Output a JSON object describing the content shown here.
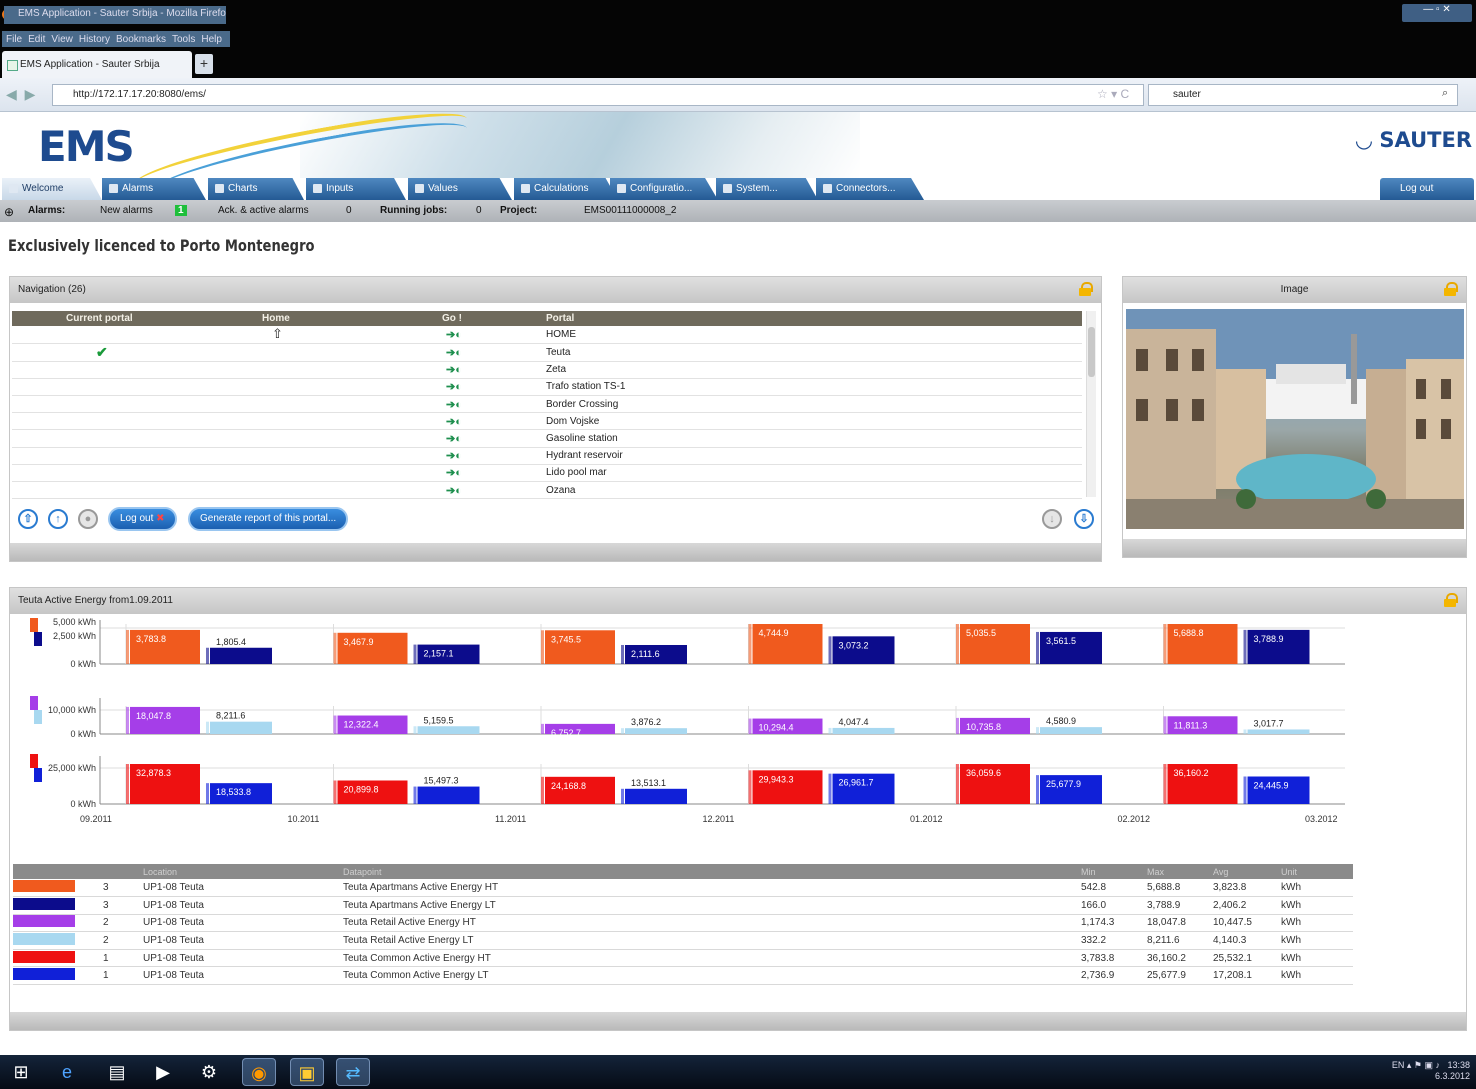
{
  "browser": {
    "window_title": "EMS Application - Sauter Srbija - Mozilla Firefox",
    "menu": [
      "File",
      "Edit",
      "View",
      "History",
      "Bookmarks",
      "Tools",
      "Help"
    ],
    "tab_title": "EMS Application - Sauter Srbija",
    "url": "http://172.17.17.20:8080/ems/",
    "search_value": "sauter"
  },
  "app": {
    "logo": "EMS",
    "brand": "SAUTER",
    "tabs": [
      "Welcome",
      "Alarms",
      "Charts",
      "Inputs",
      "Values",
      "Calculations",
      "Configuratio...",
      "System...",
      "Connectors..."
    ],
    "logout_tab": "Log out",
    "status": {
      "alarms_label": "Alarms:",
      "new_alarms_label": "New alarms",
      "new_alarms_value": "1",
      "ack_label": "Ack. & active alarms",
      "ack_value": "0",
      "jobs_label": "Running jobs:",
      "jobs_value": "0",
      "project_label": "Project:",
      "project_value": "EMS00111000008_2"
    },
    "licence": "Exclusively licenced to Porto Montenegro"
  },
  "navigation": {
    "title": "Navigation (26)",
    "columns": [
      "Current portal",
      "Home",
      "Go !",
      "Portal"
    ],
    "rows": [
      {
        "current": "",
        "home": "⇧",
        "portal": "HOME"
      },
      {
        "current": "✔",
        "home": "",
        "portal": "Teuta"
      },
      {
        "current": "",
        "home": "",
        "portal": "Zeta"
      },
      {
        "current": "",
        "home": "",
        "portal": "Trafo station TS-1"
      },
      {
        "current": "",
        "home": "",
        "portal": "Border Crossing"
      },
      {
        "current": "",
        "home": "",
        "portal": "Dom Vojske"
      },
      {
        "current": "",
        "home": "",
        "portal": "Gasoline station"
      },
      {
        "current": "",
        "home": "",
        "portal": "Hydrant reservoir"
      },
      {
        "current": "",
        "home": "",
        "portal": "Lido pool mar"
      },
      {
        "current": "",
        "home": "",
        "portal": "Ozana"
      }
    ],
    "logout_button": "Log out",
    "report_button": "Generate report of this portal..."
  },
  "image_panel": {
    "title": "Image"
  },
  "energy": {
    "title": "Teuta Active Energy from1.09.2011",
    "legend_columns": [
      "",
      "",
      "Location",
      "Datapoint",
      "Min",
      "Max",
      "Avg",
      "Unit"
    ],
    "legend_rows": [
      {
        "color": "#f05a1e",
        "level": "3",
        "location": "UP1-08 Teuta",
        "datapoint": "Teuta Apartmans Active Energy HT",
        "min": "542.8",
        "max": "5,688.8",
        "avg": "3,823.8",
        "unit": "kWh"
      },
      {
        "color": "#0c0c8c",
        "level": "3",
        "location": "UP1-08 Teuta",
        "datapoint": "Teuta Apartmans Active Energy LT",
        "min": "166.0",
        "max": "3,788.9",
        "avg": "2,406.2",
        "unit": "kWh"
      },
      {
        "color": "#a53ee8",
        "level": "2",
        "location": "UP1-08 Teuta",
        "datapoint": "Teuta Retail Active Energy HT",
        "min": "1,174.3",
        "max": "18,047.8",
        "avg": "10,447.5",
        "unit": "kWh"
      },
      {
        "color": "#a8d8f0",
        "level": "2",
        "location": "UP1-08 Teuta",
        "datapoint": "Teuta Retail Active Energy LT",
        "min": "332.2",
        "max": "8,211.6",
        "avg": "4,140.3",
        "unit": "kWh"
      },
      {
        "color": "#ee1111",
        "level": "1",
        "location": "UP1-08 Teuta",
        "datapoint": "Teuta Common Active Energy HT",
        "min": "3,783.8",
        "max": "36,160.2",
        "avg": "25,532.1",
        "unit": "kWh"
      },
      {
        "color": "#1020d8",
        "level": "1",
        "location": "UP1-08 Teuta",
        "datapoint": "Teuta Common Active Energy LT",
        "min": "2,736.9",
        "max": "25,677.9",
        "avg": "17,208.1",
        "unit": "kWh"
      }
    ]
  },
  "chart_data": {
    "type": "bar",
    "title": "Teuta Active Energy from1.09.2011",
    "categories": [
      "09.2011",
      "10.2011",
      "11.2011",
      "12.2011",
      "01.2012",
      "02.2012"
    ],
    "x_end_label": "03.2012",
    "panels": [
      {
        "ylabel_ticks": [
          "5,000 kWh",
          "2,500 kWh",
          "0 kWh"
        ],
        "ylim": [
          0,
          5000
        ],
        "series": [
          {
            "color": "#f05a1e",
            "values": [
              3783.8,
              3467.9,
              3745.5,
              4744.9,
              5035.5,
              5688.8
            ],
            "labels": [
              "3,783.8",
              "3,467.9",
              "3,745.5",
              "4,744.9",
              "5,035.5",
              "5,688.8"
            ]
          },
          {
            "color": "#0c0c8c",
            "values": [
              1805.4,
              2157.1,
              2111.6,
              3073.2,
              3561.5,
              3788.9
            ],
            "labels": [
              "1,805.4",
              "2,157.1",
              "2,111.6",
              "3,073.2",
              "3,561.5",
              "3,788.9"
            ]
          }
        ]
      },
      {
        "ylabel_ticks": [
          "10,000 kWh",
          "0 kWh"
        ],
        "ylim": [
          0,
          20000
        ],
        "series": [
          {
            "color": "#a53ee8",
            "values": [
              18047.8,
              12322.4,
              6752.7,
              10294.4,
              10735.8,
              11811.3
            ],
            "labels": [
              "18,047.8",
              "12,322.4",
              "6,752.7",
              "10,294.4",
              "10,735.8",
              "11,811.3"
            ]
          },
          {
            "color": "#a8d8f0",
            "values": [
              8211.6,
              5159.5,
              3876.2,
              4047.4,
              4580.9,
              3017.7
            ],
            "labels": [
              "8,211.6",
              "5,159.5",
              "3,876.2",
              "4,047.4",
              "4,580.9",
              "3,017.7"
            ]
          }
        ]
      },
      {
        "ylabel_ticks": [
          "25,000 kWh",
          "0 kWh"
        ],
        "ylim": [
          0,
          40000
        ],
        "series": [
          {
            "color": "#ee1111",
            "values": [
              36160.2,
              20899.8,
              24168.8,
              29943.3,
              36059.6,
              36160.2
            ],
            "labels": [
              "32,878.3",
              "20,899.8",
              "24,168.8",
              "29,943.3",
              "36,059.6",
              "36,160.2"
            ]
          },
          {
            "color": "#1020d8",
            "values": [
              18533.8,
              15497.3,
              13513.1,
              26961.7,
              25677.9,
              24445.9
            ],
            "labels": [
              "18,533.8",
              "15,497.3",
              "13,513.1",
              "26,961.7",
              "25,677.9",
              "24,445.9"
            ]
          }
        ]
      }
    ]
  },
  "taskbar": {
    "clock_time": "13:38",
    "clock_date": "6.3.2012",
    "lang": "EN"
  }
}
